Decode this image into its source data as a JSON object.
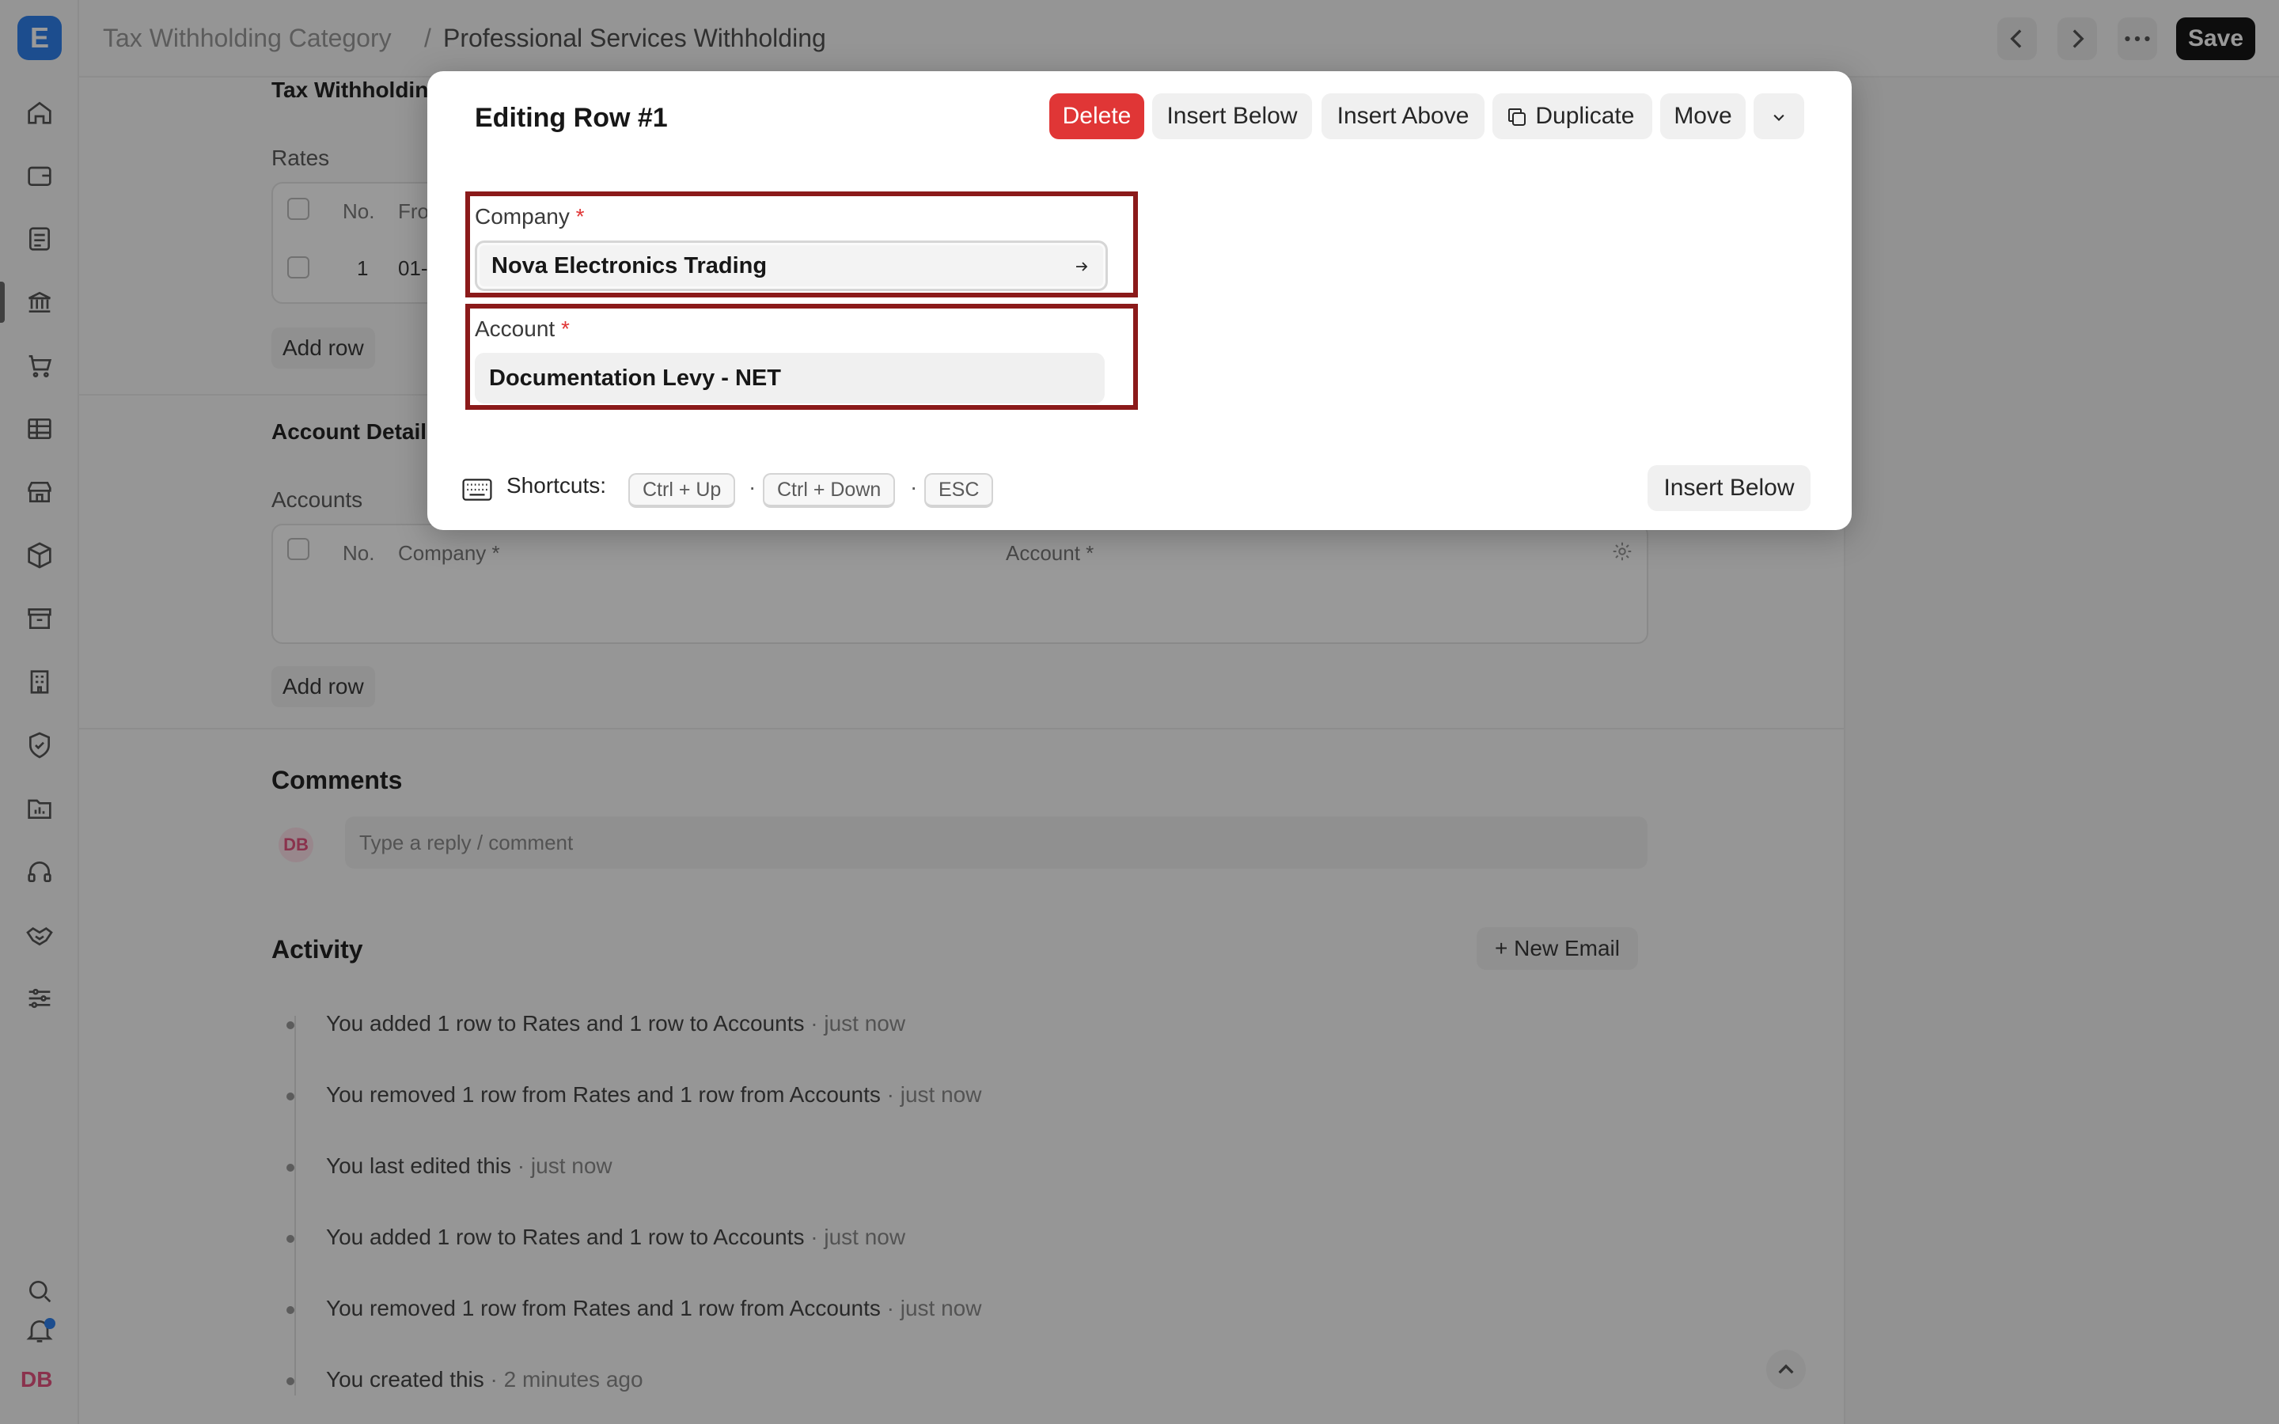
{
  "app": {
    "logo_letter": "E",
    "user_initials": "DB"
  },
  "sidebar": {
    "items": [
      {
        "icon": "home-icon"
      },
      {
        "icon": "wallet-icon"
      },
      {
        "icon": "document-icon"
      },
      {
        "icon": "bank-icon"
      },
      {
        "icon": "cart-icon"
      },
      {
        "icon": "table-icon"
      },
      {
        "icon": "store-icon"
      },
      {
        "icon": "box-icon"
      },
      {
        "icon": "archive-icon"
      },
      {
        "icon": "building-icon"
      },
      {
        "icon": "shield-icon"
      },
      {
        "icon": "chart-folder-icon"
      },
      {
        "icon": "headset-icon"
      },
      {
        "icon": "handshake-icon"
      },
      {
        "icon": "sliders-icon"
      }
    ],
    "bottom": [
      {
        "icon": "search-icon"
      },
      {
        "icon": "bell-icon"
      }
    ]
  },
  "header": {
    "breadcrumb_parent": "Tax Withholding Category",
    "separator": "/",
    "title": "Professional Services Withholding",
    "save_label": "Save"
  },
  "form": {
    "section_top": "Tax Withholdin",
    "rates_label": "Rates",
    "rates_headers": [
      "No.",
      "Fro"
    ],
    "rates_row": [
      "1",
      "01-"
    ],
    "add_row": "Add row",
    "account_details": "Account Detail",
    "accounts_label": "Accounts",
    "accounts_headers": [
      "No.",
      "Company *",
      "Account *"
    ]
  },
  "comments": {
    "title": "Comments",
    "avatar": "DB",
    "placeholder": "Type a reply / comment"
  },
  "activity": {
    "title": "Activity",
    "new_email": "+ New Email",
    "items": [
      {
        "text": "You added 1 row to Rates and 1 row to Accounts",
        "time": " · just now"
      },
      {
        "text": "You removed 1 row from Rates and 1 row from Accounts",
        "time": " · just now"
      },
      {
        "text": "You last edited this",
        "time": " · just now"
      },
      {
        "text": "You added 1 row to Rates and 1 row to Accounts",
        "time": " · just now"
      },
      {
        "text": "You removed 1 row from Rates and 1 row from Accounts",
        "time": " · just now"
      },
      {
        "text": "You created this",
        "time": " · 2 minutes ago"
      }
    ]
  },
  "dialog": {
    "title": "Editing Row #1",
    "delete_label": "Delete",
    "insert_below_label": "Insert Below",
    "insert_above_label": "Insert Above",
    "duplicate_label": "Duplicate",
    "move_label": "Move",
    "company_label": "Company",
    "company_value": "Nova Electronics Trading",
    "account_label": "Account",
    "account_value": "Documentation Levy - NET",
    "required_mark": "*",
    "shortcuts_label": "Shortcuts:",
    "shortcut_keys": [
      "Ctrl + Up",
      "Ctrl + Down",
      "ESC"
    ],
    "shortcut_sep": "·",
    "insert_below_bottom": "Insert Below"
  },
  "colors": {
    "danger": "#e03636",
    "highlight_frame": "#8b1a1a",
    "brand": "#2f80ed"
  }
}
